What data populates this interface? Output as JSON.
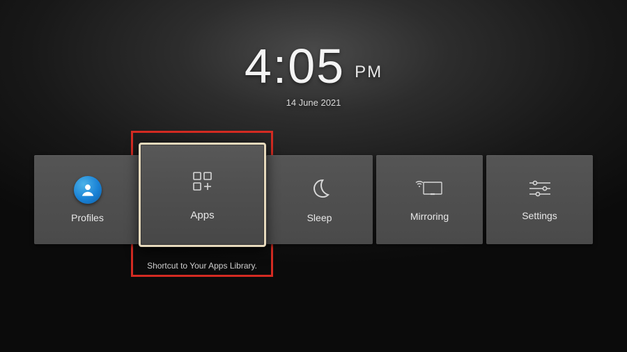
{
  "clock": {
    "time": "4:05",
    "ampm": "PM",
    "date": "14 June 2021"
  },
  "tiles": {
    "profiles": {
      "label": "Profiles",
      "icon": "profile-icon"
    },
    "apps": {
      "label": "Apps",
      "icon": "apps-icon",
      "description": "Shortcut to Your Apps Library."
    },
    "sleep": {
      "label": "Sleep",
      "icon": "moon-icon"
    },
    "mirroring": {
      "label": "Mirroring",
      "icon": "mirroring-icon"
    },
    "settings": {
      "label": "Settings",
      "icon": "sliders-icon"
    }
  },
  "colors": {
    "highlight_border": "#e6d9bc",
    "annotation_frame": "#d42b22",
    "tile_bg": "#505050"
  }
}
